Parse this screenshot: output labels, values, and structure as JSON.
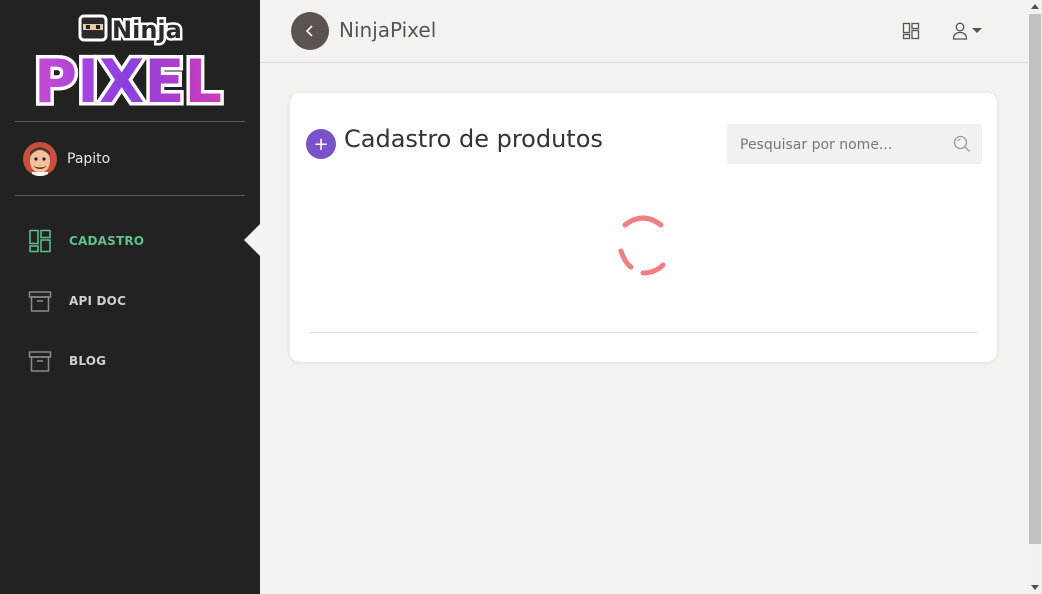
{
  "sidebar": {
    "logo": {
      "line1": "Ninja",
      "line2": "PIXEL"
    },
    "user": {
      "name": "Papito"
    },
    "items": [
      {
        "label": "CADASTRO",
        "icon": "dashboard-icon",
        "active": true
      },
      {
        "label": "API DOC",
        "icon": "archive-box-icon",
        "active": false
      },
      {
        "label": "BLOG",
        "icon": "archive-box-icon",
        "active": false
      }
    ]
  },
  "header": {
    "title": "NinjaPixel",
    "back_icon": "chevron-left-icon",
    "grid_icon": "grid-icon",
    "user_icon": "user-icon"
  },
  "main": {
    "title": "Cadastro de produtos",
    "add_label": "+",
    "search": {
      "placeholder": "Pesquisar por nome..."
    },
    "loading": true
  },
  "colors": {
    "sidebar_bg": "#222222",
    "active_green": "#5fc18d",
    "add_purple": "#7a52c9",
    "spinner_red": "#f07e83"
  }
}
